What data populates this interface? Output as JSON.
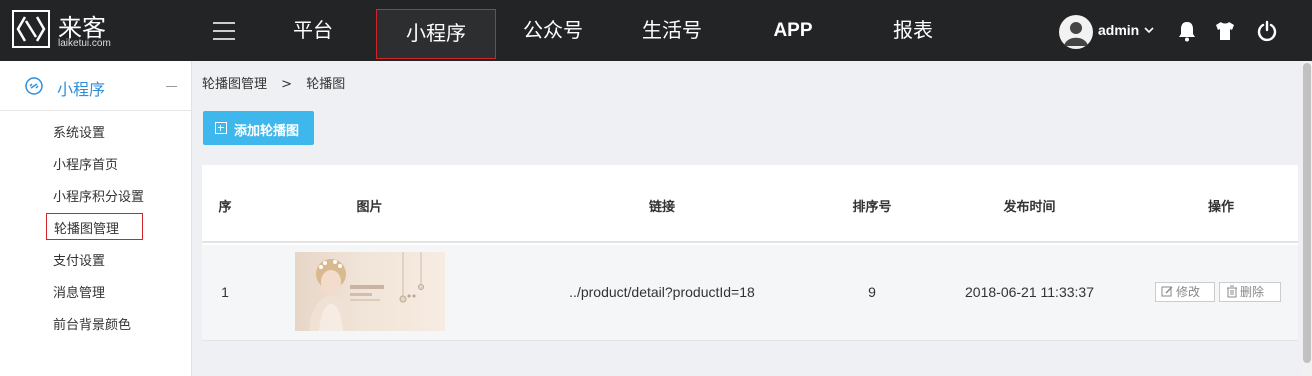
{
  "brand": {
    "name": "来客",
    "url": "laiketui.com"
  },
  "nav": {
    "items": [
      {
        "label": "平台"
      },
      {
        "label": "小程序"
      },
      {
        "label": "公众号"
      },
      {
        "label": "生活号"
      },
      {
        "label": "APP"
      },
      {
        "label": "报表"
      }
    ],
    "active_index": 1
  },
  "user": {
    "name": "admin"
  },
  "icons": {
    "menu": "menu-icon",
    "user": "user-avatar-icon",
    "dropdown": "chevron-down-icon",
    "bell": "bell-icon",
    "shirt": "shirt-icon",
    "power": "power-icon",
    "link": "link-icon",
    "plus": "plus-square-icon",
    "edit": "edit-icon",
    "trash": "trash-icon"
  },
  "colors": {
    "topbar": "#222426",
    "accent_blue": "#2f8ed9",
    "button_blue": "#3eb7ec",
    "highlight_red": "#d0262a"
  },
  "sidebar": {
    "section_title": "小程序",
    "items": [
      {
        "label": "系统设置"
      },
      {
        "label": "小程序首页"
      },
      {
        "label": "小程序积分设置"
      },
      {
        "label": "轮播图管理"
      },
      {
        "label": "支付设置"
      },
      {
        "label": "消息管理"
      },
      {
        "label": "前台背景颜色"
      }
    ],
    "active_index": 3
  },
  "breadcrumb": {
    "parent": "轮播图管理",
    "separator": ">",
    "current": "轮播图"
  },
  "toolbar": {
    "add_label": "添加轮播图"
  },
  "table": {
    "columns": [
      "序",
      "图片",
      "链接",
      "排序号",
      "发布时间",
      "操作"
    ],
    "rows": [
      {
        "index": "1",
        "link": "../product/detail?productId=18",
        "sort": "9",
        "published": "2018-06-21 11:33:37",
        "edit_label": "修改",
        "delete_label": "删除"
      }
    ]
  }
}
